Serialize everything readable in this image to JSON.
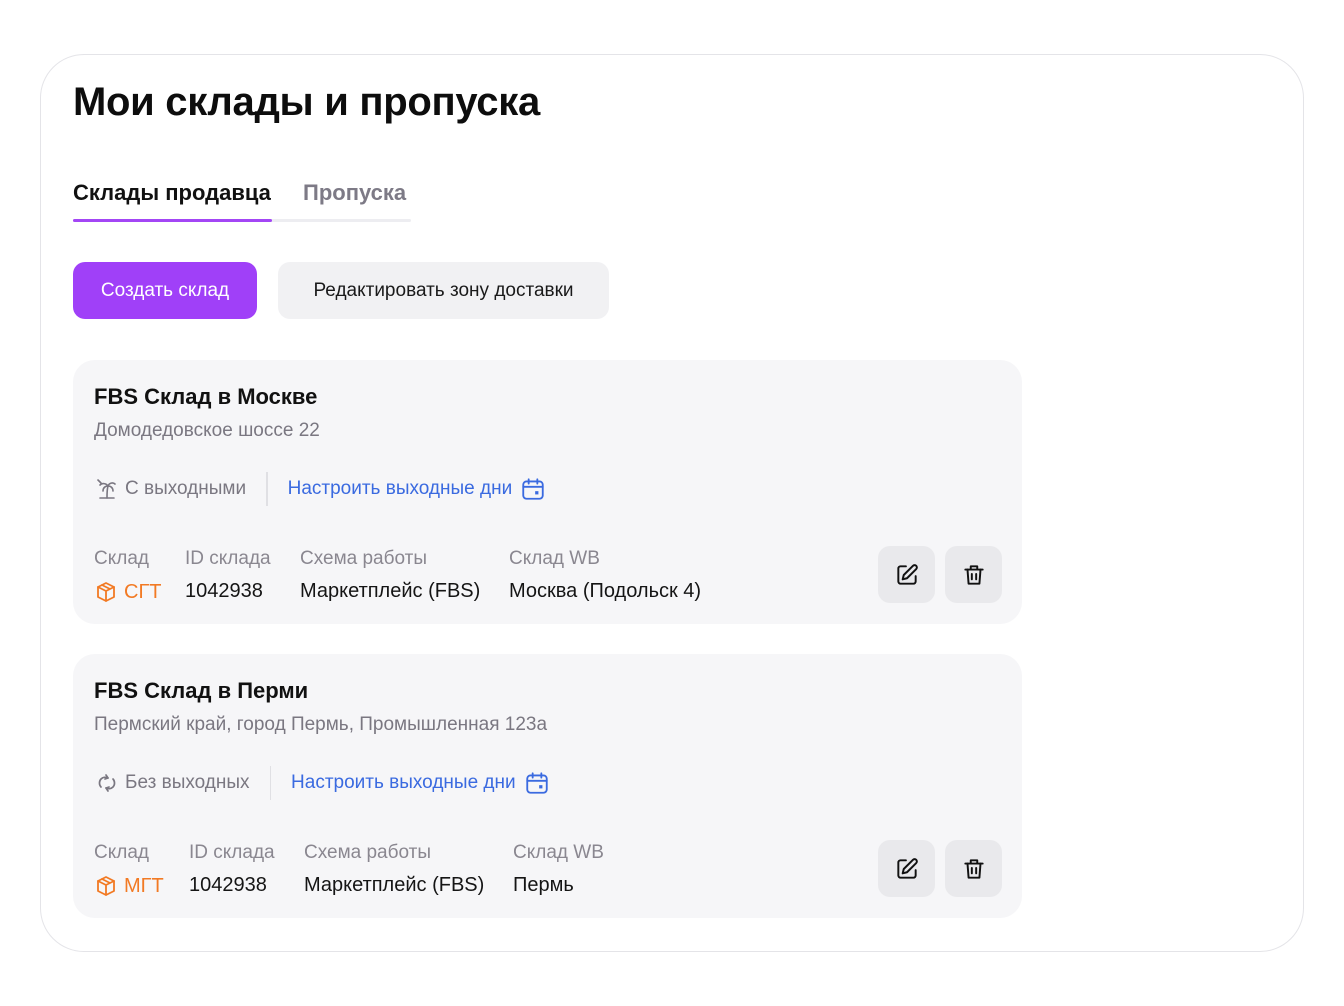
{
  "page": {
    "title": "Мои склады и пропуска"
  },
  "tabs": [
    {
      "label": "Склады продавца",
      "active": true
    },
    {
      "label": "Пропуска",
      "active": false
    }
  ],
  "actions": {
    "create_label": "Создать склад",
    "edit_zone_label": "Редактировать зону доставки"
  },
  "colors": {
    "accent": "#a040f8",
    "link": "#3a6ae0",
    "warehouse_type": "#f27a24"
  },
  "warehouses": [
    {
      "name": "FBS Склад в Москве",
      "address": "Домодедовское шоссе 22",
      "schedule_icon": "palm-tree-icon",
      "schedule": "С выходными",
      "configure_link": "Настроить выходные дни",
      "labels": {
        "type": "Склад",
        "id": "ID склада",
        "scheme": "Схема работы",
        "wb": "Склад WB"
      },
      "type": "СГТ",
      "id": "1042938",
      "scheme": "Маркетплейс (FBS)",
      "wb": "Москва (Подольск 4)"
    },
    {
      "name": "FBS Склад в Перми",
      "address": "Пермский край, город Пермь, Промышленная 123а",
      "schedule_icon": "sync-arrows-icon",
      "schedule": "Без выходных",
      "configure_link": "Настроить выходные дни",
      "labels": {
        "type": "Склад",
        "id": "ID склада",
        "scheme": "Схема работы",
        "wb": "Склад WB"
      },
      "type": "МГТ",
      "id": "1042938",
      "scheme": "Маркетплейс (FBS)",
      "wb": "Пермь"
    }
  ]
}
